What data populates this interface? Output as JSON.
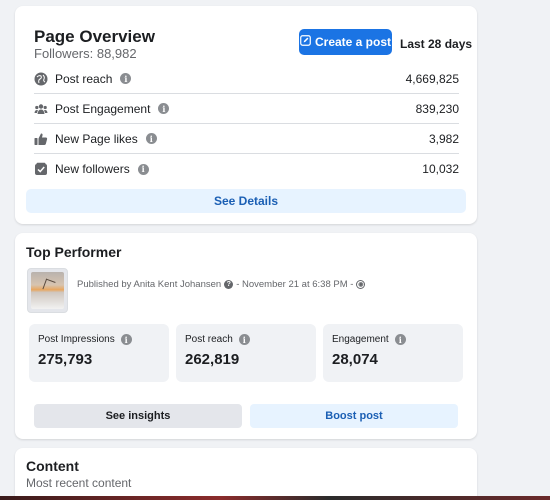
{
  "overview": {
    "title": "Page Overview",
    "followers": "Followers: 88,982",
    "create_post_label": "Create a post",
    "date_range": "Last 28 days",
    "metrics": [
      {
        "icon": "globe-icon",
        "label": "Post reach",
        "value": "4,669,825"
      },
      {
        "icon": "people-icon",
        "label": "Post Engagement",
        "value": "839,230"
      },
      {
        "icon": "thumbs-up-icon",
        "label": "New Page likes",
        "value": "3,982"
      },
      {
        "icon": "follow-check-icon",
        "label": "New followers",
        "value": "10,032"
      }
    ],
    "see_details_label": "See Details"
  },
  "top_performer": {
    "title": "Top Performer",
    "published_by": "Published by Anita Kent Johansen",
    "date_text": "- November 21 at 6:38 PM -",
    "stats": [
      {
        "label": "Post Impressions",
        "value": "275,793"
      },
      {
        "label": "Post reach",
        "value": "262,819"
      },
      {
        "label": "Engagement",
        "value": "28,074"
      }
    ],
    "insights_label": "See insights",
    "boost_label": "Boost post"
  },
  "content": {
    "title": "Content",
    "subtitle": "Most recent content"
  },
  "colors": {
    "primary_button": "#1b74e4",
    "secondary_blue_bg": "#e7f3ff",
    "link_text": "#1b5fb4",
    "page_bg": "#f0f2f5"
  }
}
